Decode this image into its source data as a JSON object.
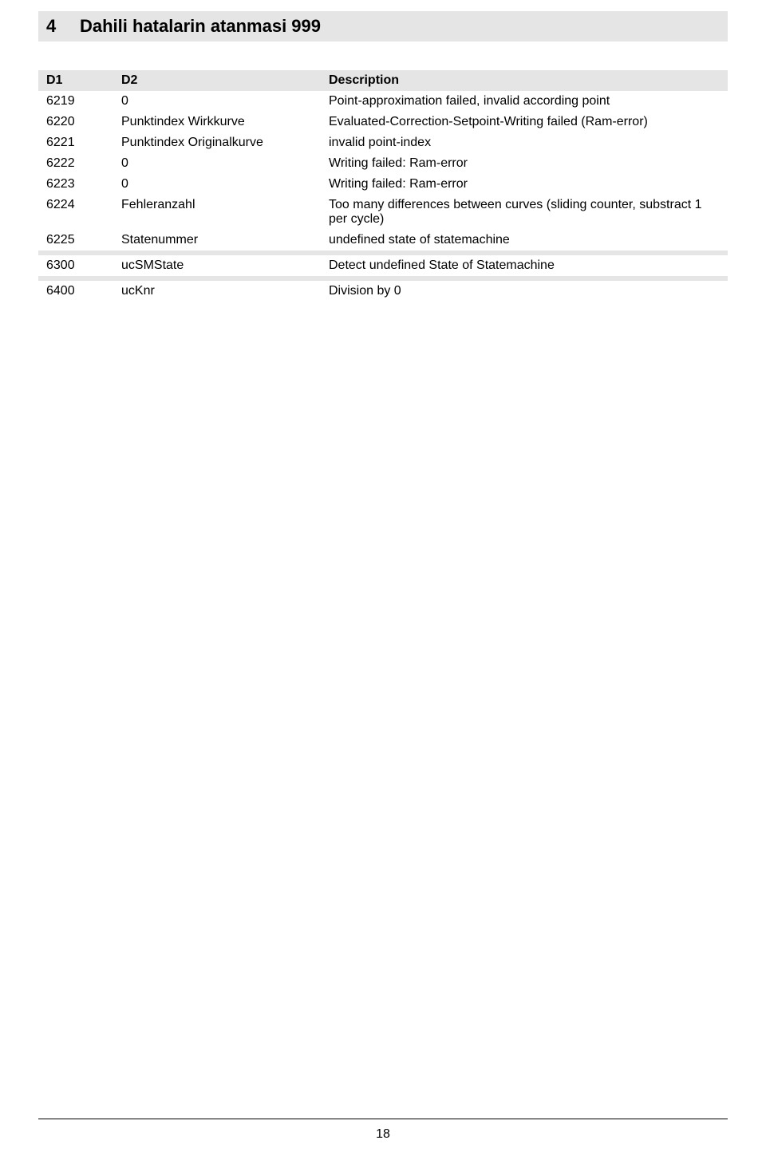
{
  "section": {
    "number": "4",
    "title": "Dahili hatalarin atanmasi 999"
  },
  "table": {
    "headers": {
      "d1": "D1",
      "d2": "D2",
      "desc": "Description"
    },
    "rows": [
      {
        "d1": "6219",
        "d2": "0",
        "desc": "Point-approximation failed, invalid according point"
      },
      {
        "d1": "6220",
        "d2": "Punktindex Wirkkurve",
        "desc": "Evaluated-Correction-Setpoint-Writing failed (Ram-error)"
      },
      {
        "d1": "6221",
        "d2": "Punktindex Originalkurve",
        "desc": "invalid point-index"
      },
      {
        "d1": "6222",
        "d2": "0",
        "desc": "Writing failed: Ram-error"
      },
      {
        "d1": "6223",
        "d2": "0",
        "desc": "Writing failed: Ram-error"
      },
      {
        "d1": "6224",
        "d2": "Fehleranzahl",
        "desc": "Too many differences between curves (sliding counter, substract 1 per cycle)"
      },
      {
        "d1": "6225",
        "d2": "Statenummer",
        "desc": "undefined state of statemachine"
      },
      {
        "sep": true
      },
      {
        "d1": "6300",
        "d2": "ucSMState",
        "desc": "Detect undefined State of Statemachine"
      },
      {
        "sep": true
      },
      {
        "d1": "6400",
        "d2": "ucKnr",
        "desc": "Division by 0"
      }
    ]
  },
  "page_number": "18"
}
